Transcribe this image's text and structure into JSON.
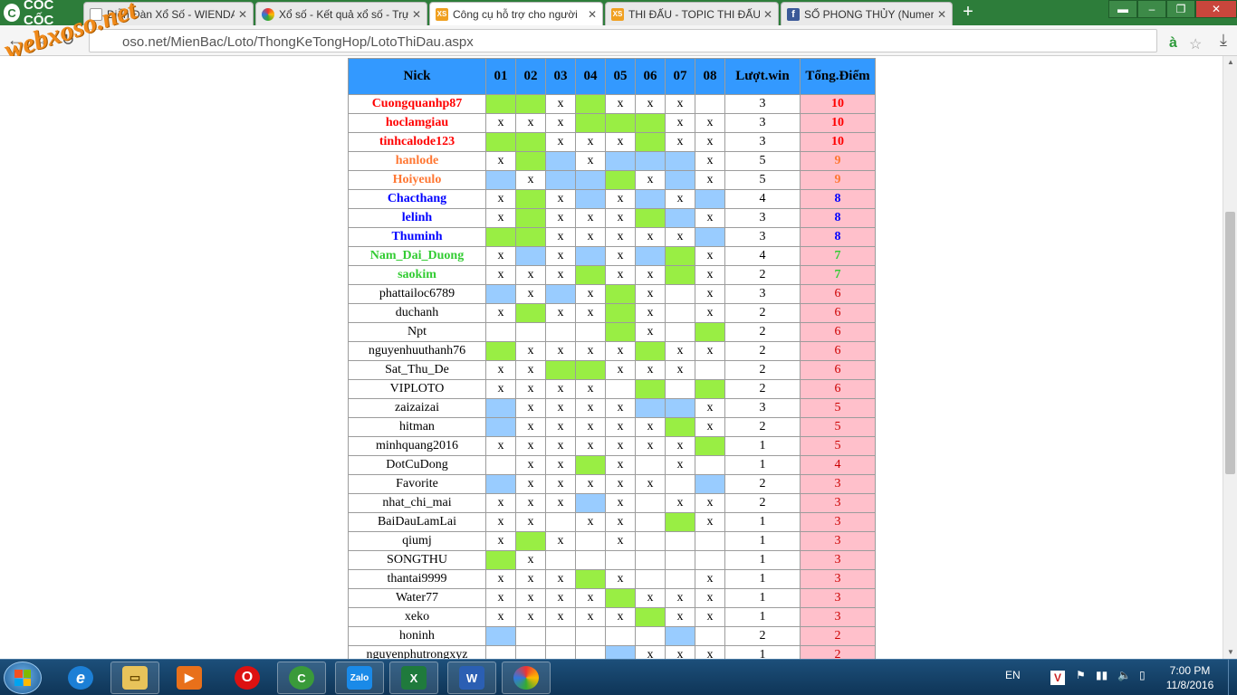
{
  "browser": {
    "logo_text": "CỐC CỐC",
    "tabs": [
      {
        "title": "Diễn Đàn Xổ Số - WIENDAN",
        "favicon": "page-icon",
        "active": false
      },
      {
        "title": "Xổ số - Kết quả xổ số - Trự",
        "favicon": "colorful-icon",
        "active": false
      },
      {
        "title": "Công cụ hỗ trợ cho người",
        "favicon": "xs-icon",
        "active": true
      },
      {
        "title": "THI ĐẤU - TOPIC THI ĐẤU",
        "favicon": "xs-icon",
        "active": false
      },
      {
        "title": "SỐ PHONG THỦY (Numer",
        "favicon": "facebook-icon",
        "active": false
      }
    ],
    "url": "oso.net/MienBac/Loto/ThongKeTongHop/LotoThiDau.aspx",
    "watermark": "webxoso.net"
  },
  "table": {
    "headers": [
      "Nick",
      "01",
      "02",
      "03",
      "04",
      "05",
      "06",
      "07",
      "08",
      "Lượt.win",
      "Tổng.Điểm"
    ],
    "rows": [
      {
        "nick": "Cuongquanhp87",
        "color": "#ff0000",
        "cells": [
          "g",
          "g",
          "x",
          "g",
          "x",
          "x",
          "x",
          ""
        ],
        "wins": "3",
        "score": "10"
      },
      {
        "nick": "hoclamgiau",
        "color": "#ff0000",
        "cells": [
          "x",
          "x",
          "x",
          "g",
          "g",
          "g",
          "x",
          "x"
        ],
        "wins": "3",
        "score": "10"
      },
      {
        "nick": "tinhcalode123",
        "color": "#ff0000",
        "cells": [
          "g",
          "g",
          "x",
          "x",
          "x",
          "g",
          "x",
          "x"
        ],
        "wins": "3",
        "score": "10"
      },
      {
        "nick": "hanlode",
        "color": "#ff7733",
        "cells": [
          "x",
          "g",
          "b",
          "x",
          "b",
          "b",
          "b",
          "x"
        ],
        "wins": "5",
        "score": "9"
      },
      {
        "nick": "Hoiyeulo",
        "color": "#ff7733",
        "cells": [
          "b",
          "x",
          "b",
          "b",
          "g",
          "x",
          "b",
          "x"
        ],
        "wins": "5",
        "score": "9"
      },
      {
        "nick": "Chacthang",
        "color": "#0000ff",
        "cells": [
          "x",
          "g",
          "x",
          "b",
          "x",
          "b",
          "x",
          "b"
        ],
        "wins": "4",
        "score": "8"
      },
      {
        "nick": "lelinh",
        "color": "#0000ff",
        "cells": [
          "x",
          "g",
          "x",
          "x",
          "x",
          "g",
          "b",
          "x"
        ],
        "wins": "3",
        "score": "8"
      },
      {
        "nick": "Thuminh",
        "color": "#0000ff",
        "cells": [
          "g",
          "g",
          "x",
          "x",
          "x",
          "x",
          "x",
          "b"
        ],
        "wins": "3",
        "score": "8"
      },
      {
        "nick": "Nam_Dai_Duong",
        "color": "#33cc33",
        "cells": [
          "x",
          "b",
          "x",
          "b",
          "x",
          "b",
          "g",
          "x"
        ],
        "wins": "4",
        "score": "7"
      },
      {
        "nick": "saokim",
        "color": "#33cc33",
        "cells": [
          "x",
          "x",
          "x",
          "g",
          "x",
          "x",
          "g",
          "x"
        ],
        "wins": "2",
        "score": "7"
      },
      {
        "nick": "phattailoc6789",
        "color": "#000000",
        "cells": [
          "b",
          "x",
          "b",
          "x",
          "g",
          "x",
          "",
          "x"
        ],
        "wins": "3",
        "score": "6"
      },
      {
        "nick": "duchanh",
        "color": "#000000",
        "cells": [
          "x",
          "g",
          "x",
          "x",
          "g",
          "x",
          "",
          "x"
        ],
        "wins": "2",
        "score": "6"
      },
      {
        "nick": "Npt",
        "color": "#000000",
        "cells": [
          "",
          "",
          "",
          "",
          "g",
          "x",
          "",
          "g"
        ],
        "wins": "2",
        "score": "6"
      },
      {
        "nick": "nguyenhuuthanh76",
        "color": "#000000",
        "cells": [
          "g",
          "x",
          "x",
          "x",
          "x",
          "g",
          "x",
          "x"
        ],
        "wins": "2",
        "score": "6"
      },
      {
        "nick": "Sat_Thu_De",
        "color": "#000000",
        "cells": [
          "x",
          "x",
          "g",
          "g",
          "x",
          "x",
          "x",
          ""
        ],
        "wins": "2",
        "score": "6"
      },
      {
        "nick": "VIPLOTO",
        "color": "#000000",
        "cells": [
          "x",
          "x",
          "x",
          "x",
          "",
          "g",
          "",
          "g"
        ],
        "wins": "2",
        "score": "6"
      },
      {
        "nick": "zaizaizai",
        "color": "#000000",
        "cells": [
          "b",
          "x",
          "x",
          "x",
          "x",
          "b",
          "b",
          "x"
        ],
        "wins": "3",
        "score": "5"
      },
      {
        "nick": "hitman",
        "color": "#000000",
        "cells": [
          "b",
          "x",
          "x",
          "x",
          "x",
          "x",
          "g",
          "x"
        ],
        "wins": "2",
        "score": "5"
      },
      {
        "nick": "minhquang2016",
        "color": "#000000",
        "cells": [
          "x",
          "x",
          "x",
          "x",
          "x",
          "x",
          "x",
          "g"
        ],
        "wins": "1",
        "score": "5"
      },
      {
        "nick": "DotCuDong",
        "color": "#000000",
        "cells": [
          "",
          "x",
          "x",
          "g",
          "x",
          "",
          "x",
          ""
        ],
        "wins": "1",
        "score": "4"
      },
      {
        "nick": "Favorite",
        "color": "#000000",
        "cells": [
          "b",
          "x",
          "x",
          "x",
          "x",
          "x",
          "",
          "b"
        ],
        "wins": "2",
        "score": "3"
      },
      {
        "nick": "nhat_chi_mai",
        "color": "#000000",
        "cells": [
          "x",
          "x",
          "x",
          "b",
          "x",
          "",
          "x",
          "x"
        ],
        "wins": "2",
        "score": "3"
      },
      {
        "nick": "BaiDauLamLai",
        "color": "#000000",
        "cells": [
          "x",
          "x",
          "",
          "x",
          "x",
          "",
          "g",
          "x"
        ],
        "wins": "1",
        "score": "3"
      },
      {
        "nick": "qiumj",
        "color": "#000000",
        "cells": [
          "x",
          "g",
          "x",
          "",
          "x",
          "",
          "",
          ""
        ],
        "wins": "1",
        "score": "3"
      },
      {
        "nick": "SONGTHU",
        "color": "#000000",
        "cells": [
          "g",
          "x",
          "",
          "",
          "",
          "",
          "",
          ""
        ],
        "wins": "1",
        "score": "3"
      },
      {
        "nick": "thantai9999",
        "color": "#000000",
        "cells": [
          "x",
          "x",
          "x",
          "g",
          "x",
          "",
          "",
          "x"
        ],
        "wins": "1",
        "score": "3"
      },
      {
        "nick": "Water77",
        "color": "#000000",
        "cells": [
          "x",
          "x",
          "x",
          "x",
          "g",
          "x",
          "x",
          "x"
        ],
        "wins": "1",
        "score": "3"
      },
      {
        "nick": "xeko",
        "color": "#000000",
        "cells": [
          "x",
          "x",
          "x",
          "x",
          "x",
          "g",
          "x",
          "x"
        ],
        "wins": "1",
        "score": "3"
      },
      {
        "nick": "honinh",
        "color": "#000000",
        "cells": [
          "b",
          "",
          "",
          "",
          "",
          "",
          "b",
          ""
        ],
        "wins": "2",
        "score": "2"
      },
      {
        "nick": "nguyenphutrongxyz",
        "color": "#000000",
        "cells": [
          "",
          "",
          "",
          "",
          "b",
          "x",
          "x",
          "x"
        ],
        "wins": "1",
        "score": "2"
      }
    ],
    "mark_colors": {
      "g": "#99ee44",
      "b": "#99ccff"
    },
    "mark_symbol": "x"
  },
  "taskbar": {
    "apps": [
      "start",
      "ie-icon",
      "explorer-icon",
      "media-player-icon",
      "opera-icon",
      "coccoc-icon",
      "zalo-icon",
      "excel-icon",
      "word-icon",
      "paint-icon"
    ],
    "zalo_label": "Zalo",
    "language": "EN",
    "clock_time": "7:00 PM",
    "clock_date": "11/8/2016"
  }
}
